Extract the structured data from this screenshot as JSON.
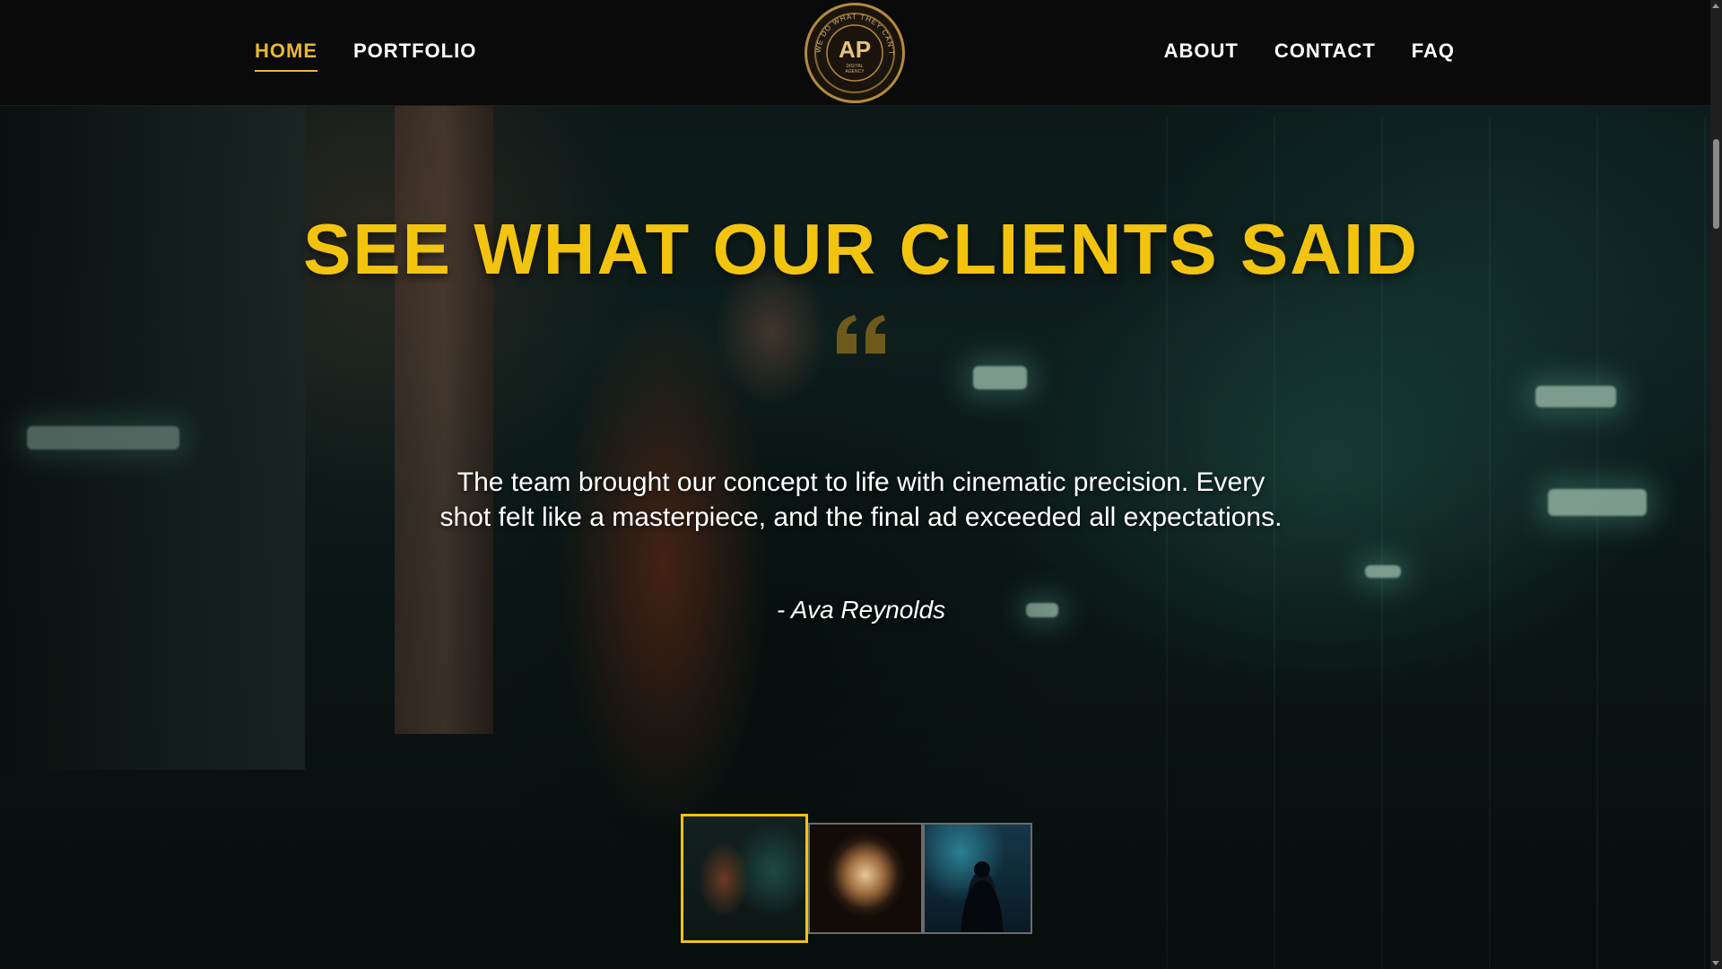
{
  "nav": {
    "left": [
      {
        "label": "HOME",
        "active": true
      },
      {
        "label": "PORTFOLIO",
        "active": false
      }
    ],
    "right": [
      {
        "label": "ABOUT"
      },
      {
        "label": "CONTACT"
      },
      {
        "label": "FAQ"
      }
    ],
    "logo": {
      "monogram": "AP",
      "ring_text": "WE DO WHAT THEY CAN'T",
      "subtitle_line1": "DIGITAL",
      "subtitle_line2": "AGENCY"
    }
  },
  "hero": {
    "title": "SEE WHAT OUR CLIENTS SAID",
    "quote_icon": "quote-icon",
    "testimonial": "The team brought our concept to life with cinematic precision. Every shot felt like a masterpiece, and the final ad exceeded all expectations.",
    "author": "- Ava Reynolds"
  },
  "thumbnails": {
    "active_index": 0,
    "count": 3
  },
  "colors": {
    "accent": "#f2c40f",
    "nav_active": "#e7b835",
    "header_bg": "#0a0a0a",
    "text": "#ffffff"
  }
}
